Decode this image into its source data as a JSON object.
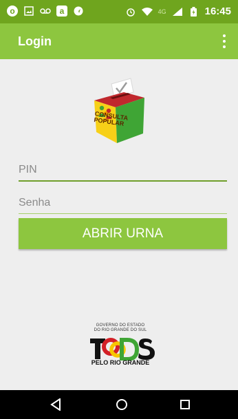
{
  "status_bar": {
    "time": "16:45",
    "network": "4G",
    "icons": [
      "o-icon",
      "image-icon",
      "voicemail-icon",
      "amazon-icon",
      "navigation-icon",
      "alarm-icon",
      "wifi-icon",
      "signal-icon",
      "battery-icon"
    ]
  },
  "app_bar": {
    "title": "Login",
    "overflow_icon": "more-vert-icon"
  },
  "logo": {
    "text_line1": "CONSULTA",
    "text_line2": "POPULAR"
  },
  "form": {
    "pin_placeholder": "PIN",
    "password_placeholder": "Senha",
    "submit_label": "ABRIR URNA"
  },
  "footer_brand": {
    "gov_line1": "GOVERNO DO ESTADO",
    "gov_line2": "DO RIO GRANDE DO SUL",
    "tagline": "PELO RIO GRANDE"
  },
  "nav_bar": {
    "icons": [
      "back-icon",
      "home-icon",
      "recents-icon"
    ]
  },
  "colors": {
    "status_bar": "#6fa51e",
    "app_bar": "#8dc63f",
    "background": "#eeeeee",
    "nav_bar": "#000000"
  }
}
